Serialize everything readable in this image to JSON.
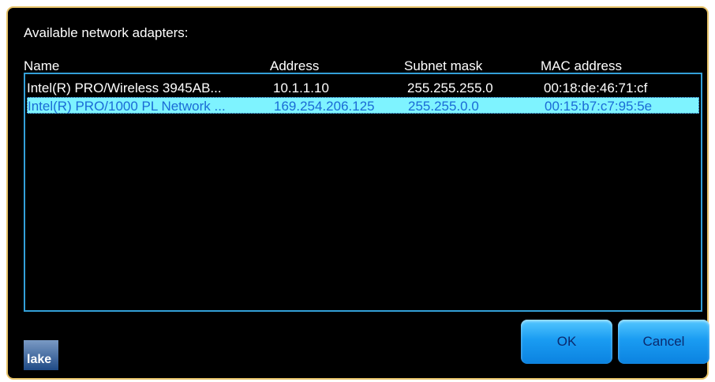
{
  "dialog": {
    "title": "Available network adapters:",
    "columns": [
      "Name",
      "Address",
      "Subnet mask",
      "MAC address"
    ],
    "rows": [
      {
        "name": "Intel(R) PRO/Wireless 3945AB...",
        "address": "10.1.1.10",
        "subnet": "255.255.255.0",
        "mac": "00:18:de:46:71:cf",
        "selected": false
      },
      {
        "name": "Intel(R) PRO/1000 PL Network ...",
        "address": "169.254.206.125",
        "subnet": "255.255.0.0",
        "mac": "00:15:b7:c7:95:5e",
        "selected": true
      }
    ],
    "ok_label": "OK",
    "cancel_label": "Cancel",
    "logo_text": "lake"
  },
  "colors": {
    "border_gold": "#e7c36a",
    "list_border": "#33a0d8",
    "selected_bg": "#7ef3ff",
    "selected_text": "#1a6bd6",
    "button_blue": "#1a9cf2"
  }
}
